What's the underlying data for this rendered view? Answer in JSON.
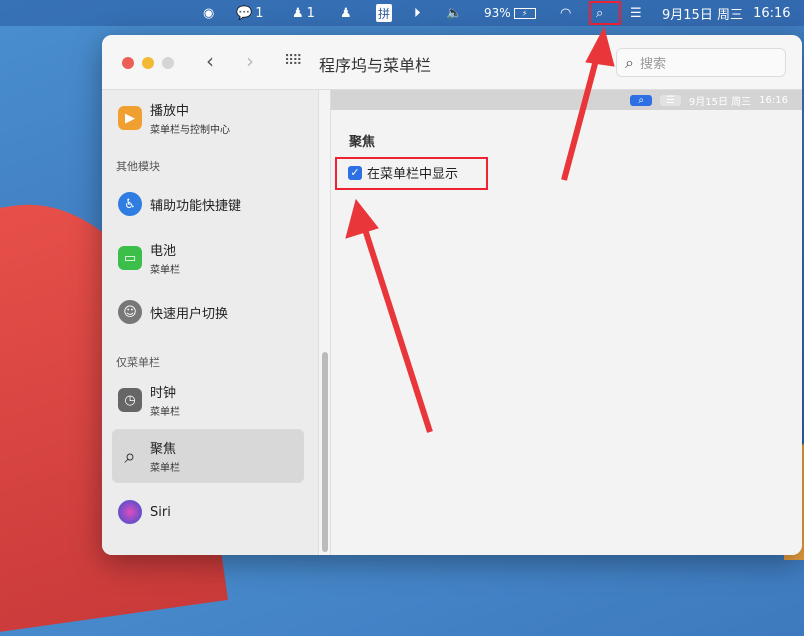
{
  "menubar": {
    "wechat_count": "1",
    "qq_count": "1",
    "input_method": "拼",
    "battery": "93%",
    "date": "9月15日 周三",
    "time": "16:16"
  },
  "window": {
    "title": "程序坞与菜单栏",
    "search_placeholder": "搜索"
  },
  "sidebar": {
    "now_playing": {
      "label": "播放中",
      "sub": "菜单栏与控制中心"
    },
    "section_other": "其他模块",
    "accessibility": {
      "label": "辅助功能快捷键"
    },
    "battery": {
      "label": "电池",
      "sub": "菜单栏"
    },
    "user_switch": {
      "label": "快速用户切换"
    },
    "section_menubar_only": "仅菜单栏",
    "clock": {
      "label": "时钟",
      "sub": "菜单栏"
    },
    "spotlight": {
      "label": "聚焦",
      "sub": "菜单栏"
    },
    "siri": {
      "label": "Siri"
    }
  },
  "preview": {
    "date": "9月15日 周三",
    "time": "16:16"
  },
  "content": {
    "heading": "聚焦",
    "show_in_menubar": "在菜单栏中显示",
    "checked": true
  },
  "colors": {
    "accent": "#2f6fe4",
    "annotation": "#e8363a"
  }
}
